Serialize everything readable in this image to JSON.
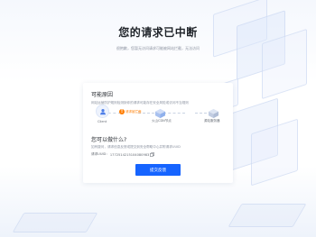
{
  "page": {
    "title": "您的请求已中断",
    "subtitle": "很抱歉，您暂无访问请求可能被网站拦截，无法访问"
  },
  "card": {
    "reason_title": "可能原因",
    "reason_desc": "网站运营防护规则检测到你的请求可能存在安全风险或访问不当规则",
    "flow": {
      "client_label": "Client",
      "blocked_label": "请求被拦截",
      "cdn_label": "火山CDN节点",
      "source_label": "源站服务器"
    },
    "help_title": "您可以做什么?",
    "help_desc": "如有疑问，请求信息反馈或提交到安全帮助中心并附请求UUID",
    "request_id_label": "请求UUID：",
    "request_id_value": "1772514215104080983",
    "feedback_button": "提交反馈"
  },
  "colors": {
    "accent": "#1664ff",
    "warning": "#ff7d00"
  },
  "icons": [
    "user-icon",
    "error-icon",
    "cdn-node-icon",
    "server-icon",
    "copy-icon"
  ]
}
